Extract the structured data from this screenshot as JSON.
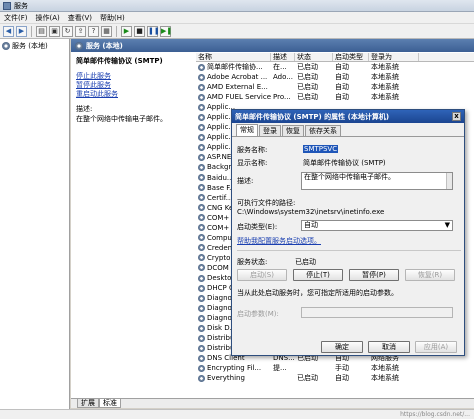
{
  "window": {
    "title": "服务"
  },
  "menu": [
    "文件(F)",
    "操作(A)",
    "查看(V)",
    "帮助(H)"
  ],
  "toolbar": {
    "icons": [
      "back-arrow-icon",
      "forward-arrow-icon",
      "console-tree-icon",
      "properties-icon",
      "refresh-icon",
      "export-icon",
      "help-icon",
      "show-hide-icon",
      "start-icon",
      "stop-icon",
      "pause-icon",
      "restart-icon"
    ]
  },
  "left_tree": {
    "root": "服务 (本地)"
  },
  "panel_header": "服务 (本地)",
  "description_pane": {
    "service_name": "简单邮件传输协议 (SMTP)",
    "stop_link": "停止此服务",
    "pause_link": "暂停此服务",
    "restart_link": "重启动此服务",
    "desc_label": "描述:",
    "desc_text": "在整个网络中传输电子邮件。"
  },
  "table": {
    "headers": [
      "名称",
      "描述",
      "状态",
      "启动类型",
      "登录为"
    ],
    "rows": [
      [
        "简单邮件传输协...",
        "在...",
        "已启动",
        "自动",
        "本地系统"
      ],
      [
        "Adobe Acrobat ...",
        "Ado...",
        "已启动",
        "自动",
        "本地系统"
      ],
      [
        "AMD External E...",
        "",
        "已启动",
        "自动",
        "本地系统"
      ],
      [
        "AMD FUEL Service",
        "Pro...",
        "已启动",
        "自动",
        "本地系统"
      ],
      [
        "Applic...",
        "",
        "",
        "",
        ""
      ],
      [
        "Applic...",
        "",
        "",
        "",
        ""
      ],
      [
        "Applic...",
        "",
        "",
        "",
        ""
      ],
      [
        "Applic...",
        "",
        "",
        "",
        ""
      ],
      [
        "Applic...",
        "",
        "",
        "",
        ""
      ],
      [
        "ASP.NE...",
        "",
        "",
        "",
        ""
      ],
      [
        "Backgr...",
        "",
        "",
        "",
        ""
      ],
      [
        "Baidu...",
        "",
        "",
        "",
        ""
      ],
      [
        "Base F...",
        "",
        "",
        "",
        ""
      ],
      [
        "Certif...",
        "",
        "",
        "",
        ""
      ],
      [
        "CNG Ke...",
        "",
        "",
        "",
        ""
      ],
      [
        "COM+ E...",
        "",
        "",
        "",
        ""
      ],
      [
        "COM+ S...",
        "",
        "",
        "",
        ""
      ],
      [
        "Comput...",
        "",
        "",
        "",
        ""
      ],
      [
        "Creden...",
        "",
        "",
        "",
        ""
      ],
      [
        "Crypto...",
        "",
        "",
        "",
        ""
      ],
      [
        "DCOM S...",
        "",
        "",
        "",
        ""
      ],
      [
        "Deskto...",
        "",
        "",
        "",
        ""
      ],
      [
        "DHCP C...",
        "",
        "",
        "",
        ""
      ],
      [
        "Diagno...",
        "",
        "",
        "",
        ""
      ],
      [
        "Diagno...",
        "",
        "",
        "",
        ""
      ],
      [
        "Diagno...",
        "",
        "",
        "",
        ""
      ],
      [
        "Disk D...",
        "",
        "",
        "",
        ""
      ],
      [
        "Distributed Li...",
        "维...",
        "已启动",
        "自动",
        "本地系统"
      ],
      [
        "Distributed Tr...",
        "协调...",
        "",
        "手动",
        "网络服务"
      ],
      [
        "DNS Client",
        "DNS...",
        "已启动",
        "自动",
        "网络服务"
      ],
      [
        "Encrypting Fil...",
        "提...",
        "",
        "手动",
        "本地系统"
      ],
      [
        "Everything",
        "",
        "已启动",
        "自动",
        "本地系统"
      ]
    ]
  },
  "bottom_tabs": [
    "扩展",
    "标准"
  ],
  "watermark": "https://blog.csdn.net/...",
  "dialog": {
    "title": "简单邮件传输协议 (SMTP) 的属性 (本地计算机)",
    "tabs": [
      "常规",
      "登录",
      "恢复",
      "依存关系"
    ],
    "service_name_label": "服务名称:",
    "service_name_value": "SMTPSVC",
    "display_name_label": "显示名称:",
    "display_name_value": "简单邮件传输协议 (SMTP)",
    "description_label": "描述:",
    "description_value": "在整个网络中传输电子邮件。",
    "exe_path_label": "可执行文件的路径:",
    "exe_path_value": "C:\\Windows\\system32\\inetsrv\\inetinfo.exe",
    "startup_type_label": "启动类型(E):",
    "startup_type_value": "自动",
    "help_link": "帮助我配置服务启动选项。",
    "service_status_label": "服务状态:",
    "service_status_value": "已启动",
    "start_btn": "启动(S)",
    "stop_btn": "停止(T)",
    "pause_btn": "暂停(P)",
    "resume_btn": "恢复(R)",
    "hint_text": "当从此处启动服务时，您可指定所适用的启动参数。",
    "start_params_label": "启动参数(M):",
    "ok_btn": "确定",
    "cancel_btn": "取消",
    "apply_btn": "应用(A)",
    "close_glyph": "x"
  }
}
